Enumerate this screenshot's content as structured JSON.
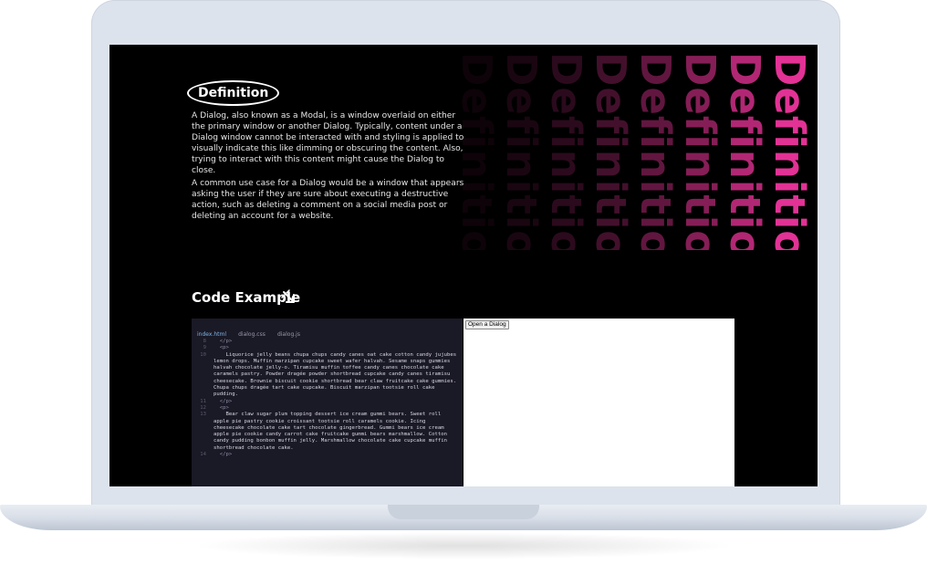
{
  "definition": {
    "heading": "Definition",
    "paragraphs": [
      "A Dialog, also known as a Modal, is a window overlaid on either the primary window or another Dialog. Typically, content under a Dialog window cannot be interacted with and styling is applied to visually indicate this like dimming or obscuring the content. Also, trying to interact with this content might cause the Dialog to close.",
      "A common use case for a Dialog would be a window that appears asking the user if they are sure about executing a destructive action, such as deleting a comment on a social media post or deleting an account for a website."
    ],
    "decorative_word": "Definition",
    "decorative_colors": [
      "#2a0a1c",
      "#3c0f28",
      "#521436",
      "#6b1a46",
      "#871f58",
      "#a4256b",
      "#c42b80",
      "#e23295"
    ]
  },
  "code_example": {
    "heading": "Code Example",
    "tabs": [
      "index.html",
      "dialog.css",
      "dialog.js"
    ],
    "active_tab": "index.html",
    "lines": [
      {
        "n": "8",
        "text": "  </p>"
      },
      {
        "n": "9",
        "text": "  <p>"
      },
      {
        "n": "10",
        "text": "    Liquorice jelly beans chupa chups candy canes oat cake cotton candy jujubes lemon drops. Muffin marzipan cupcake sweet wafer halvah. Sesame snaps gummies halvah chocolate jelly-o. Tiramisu muffin toffee candy canes chocolate cake caramels pastry. Powder dragée powder shortbread cupcake candy canes tiramisu cheesecake. Brownie biscuit cookie shortbread bear claw fruitcake cake gummies. Chupa chups dragée tart cake cupcake. Biscuit marzipan tootsie roll cake pudding."
      },
      {
        "n": "11",
        "text": "  </p>"
      },
      {
        "n": "12",
        "text": "  <p>"
      },
      {
        "n": "13",
        "text": "    Bear claw sugar plum topping dessert ice cream gummi bears. Sweet roll apple pie pastry cookie croissant tootsie roll caramels cookie. Icing cheesecake chocolate cake tart chocolate gingerbread. Gummi bears ice cream apple pie cookie candy carrot cake fruitcake gummi bears marshmallow. Cotton candy pudding bonbon muffin jelly. Marshmallow chocolate cake cupcake muffin shortbread chocolate cake."
      },
      {
        "n": "14",
        "text": "  </p>"
      }
    ],
    "preview_button": "Open a Dialog"
  },
  "colors": {
    "screen_bg": "#000000",
    "code_bg": "#1a1926",
    "accent_pink": "#e23295",
    "tab_active": "#7fb6e6"
  }
}
